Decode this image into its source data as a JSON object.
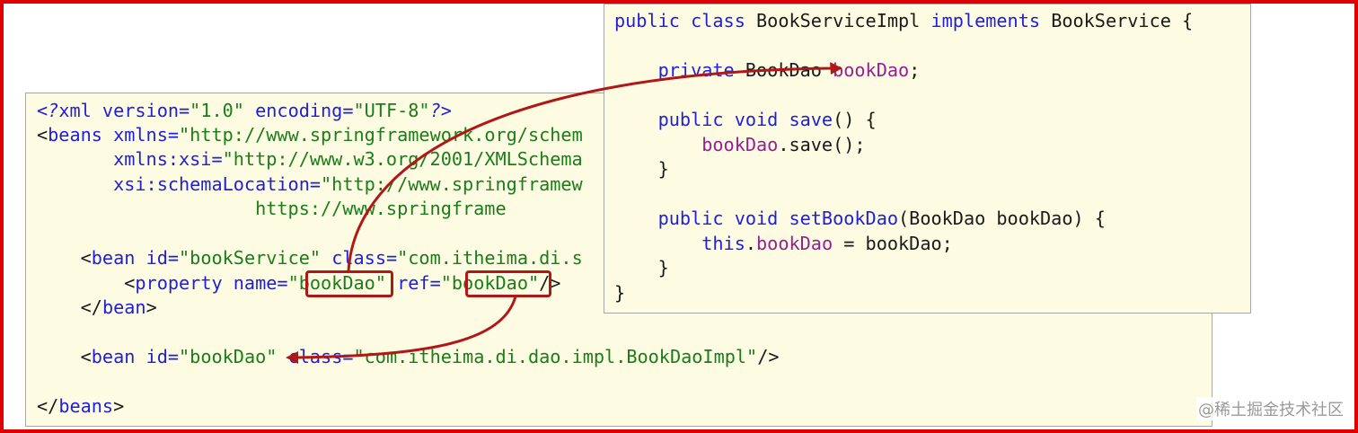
{
  "xml_lines": [
    [
      "<?",
      "xml version=",
      "\"1.0\"",
      " encoding=",
      "\"UTF-8\"",
      "?>"
    ],
    [
      "<",
      "beans ",
      "xmlns=",
      "\"http://www.springframework.org/schem"
    ],
    [
      "       ",
      "xmlns:xsi=",
      "\"http://www.w3.org/2001/XMLSchema"
    ],
    [
      "       ",
      "xsi:schemaLocation=",
      "\"http://www.springframew"
    ],
    [
      "                    ",
      "https://www.springframe"
    ],
    [
      ""
    ],
    [
      "    <",
      "bean ",
      "id=",
      "\"bookService\"",
      " class=",
      "\"com.itheima.di.s"
    ],
    [
      "        <",
      "property ",
      "name=",
      "\"",
      "bookDao",
      "\"",
      " ref=",
      "\"",
      "bookDao",
      "\"",
      "/>"
    ],
    [
      "    </",
      "bean",
      ">"
    ],
    [
      ""
    ],
    [
      "    <",
      "bean ",
      "id=",
      "\"bookDao\"",
      " class=",
      "\"com.itheima.di.dao.impl.BookDaoImpl\"",
      "/>"
    ],
    [
      ""
    ],
    [
      "</",
      "beans",
      ">"
    ]
  ],
  "java_lines": [
    [
      "public class ",
      "BookServiceImpl ",
      "implements ",
      "BookService {"
    ],
    [
      ""
    ],
    [
      "    private ",
      "BookDao ",
      "bookDao",
      ";"
    ],
    [
      ""
    ],
    [
      "    public void ",
      "save",
      "() {"
    ],
    [
      "        ",
      "bookDao",
      ".save();"
    ],
    [
      "    }"
    ],
    [
      ""
    ],
    [
      "    public void ",
      "setBookDao",
      "(BookDao bookDao) {"
    ],
    [
      "        ",
      "this",
      ".",
      "bookDao",
      " = bookDao;"
    ],
    [
      "    }"
    ],
    [
      "}"
    ]
  ],
  "watermark": "@稀土掘金技术社区",
  "colors": {
    "border": "#e00000",
    "arrow": "#b01818",
    "panel_bg": "#fdfbe1",
    "keyword": "#1f1fd9",
    "string": "#1a7d1a",
    "field": "#951f95"
  }
}
